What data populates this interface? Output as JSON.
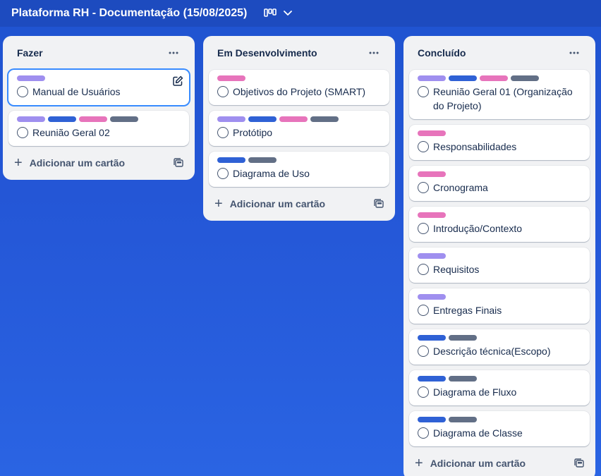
{
  "board": {
    "title": "Plataforma RH - Documentação (15/08/2025)"
  },
  "colors": {
    "purple": "#9f8fef",
    "blue": "#2f61d5",
    "pink": "#e774bb",
    "gray": "#626f86"
  },
  "lists": [
    {
      "title": "Fazer",
      "add_label": "Adicionar um cartão",
      "cards": [
        {
          "title": "Manual de Usuários",
          "labels": [
            "purple"
          ]
        },
        {
          "title": "Reunião Geral 02",
          "labels": [
            "purple",
            "blue",
            "pink",
            "gray"
          ]
        }
      ]
    },
    {
      "title": "Em Desenvolvimento",
      "add_label": "Adicionar um cartão",
      "cards": [
        {
          "title": "Objetivos do Projeto (SMART)",
          "labels": [
            "pink"
          ]
        },
        {
          "title": "Protótipo",
          "labels": [
            "purple",
            "blue",
            "pink",
            "gray"
          ]
        },
        {
          "title": "Diagrama de Uso",
          "labels": [
            "blue",
            "gray"
          ]
        }
      ]
    },
    {
      "title": "Concluído",
      "add_label": "Adicionar um cartão",
      "cards": [
        {
          "title": "Reunião Geral 01 (Organização do Projeto)",
          "labels": [
            "purple",
            "blue",
            "pink",
            "gray"
          ]
        },
        {
          "title": "Responsabilidades",
          "labels": [
            "pink"
          ]
        },
        {
          "title": "Cronograma",
          "labels": [
            "pink"
          ]
        },
        {
          "title": "Introdução/Contexto",
          "labels": [
            "pink"
          ]
        },
        {
          "title": "Requisitos",
          "labels": [
            "purple"
          ]
        },
        {
          "title": "Entregas Finais",
          "labels": [
            "purple"
          ]
        },
        {
          "title": "Descrição técnica(Escopo)",
          "labels": [
            "blue",
            "gray"
          ]
        },
        {
          "title": "Diagrama de Fluxo",
          "labels": [
            "blue",
            "gray"
          ]
        },
        {
          "title": "Diagrama de Classe",
          "labels": [
            "blue",
            "gray"
          ]
        }
      ]
    }
  ]
}
